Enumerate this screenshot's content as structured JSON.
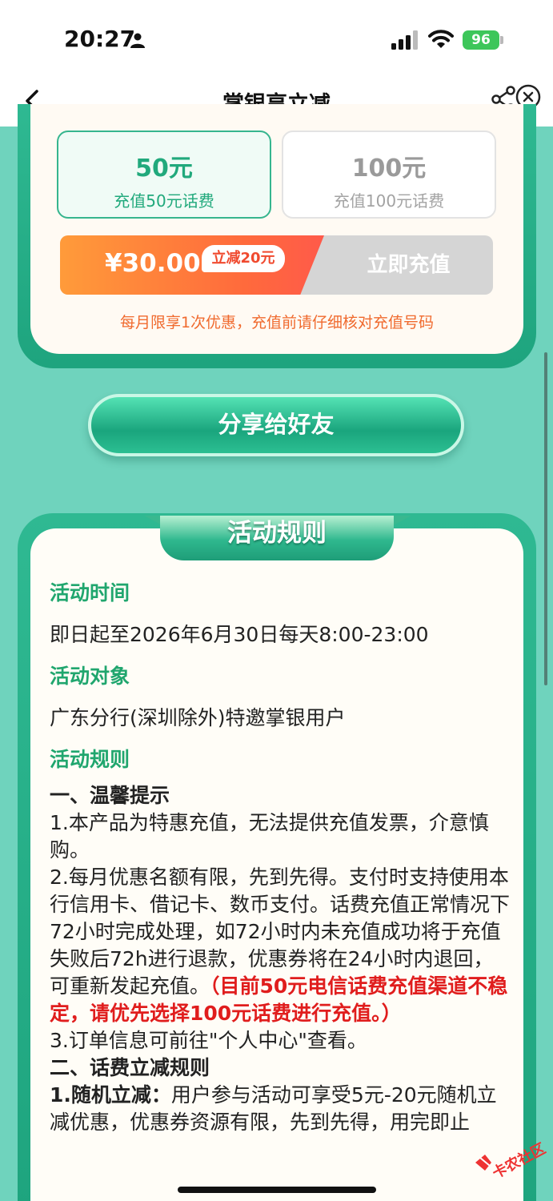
{
  "status_bar": {
    "time": "20:27",
    "battery": "96"
  },
  "nav": {
    "title": "掌银享立减"
  },
  "amount_options": [
    {
      "value": "50元",
      "desc": "充值50元话费",
      "selected": true
    },
    {
      "value": "100元",
      "desc": "充值100元话费",
      "selected": false
    }
  ],
  "pay": {
    "price": "¥30.00",
    "discount_tag": "立减20元",
    "button_label": "立即充值",
    "note": "每月限享1次优惠，充值前请仔细核对充值号码"
  },
  "share_button": "分享给好友",
  "rules": {
    "tab_title": "活动规则",
    "time_heading": "活动时间",
    "time_text": "即日起至2026年6月30日每天8:00-23:00",
    "target_heading": "活动对象",
    "target_text": "广东分行(深圳除外)特邀掌银用户",
    "rules_heading": "活动规则",
    "tips_heading": "一、温馨提示",
    "tip1": "1.本产品为特惠充值，无法提供充值发票，介意慎购。",
    "tip2": "2.每月优惠名额有限，先到先得。支付时支持使用本行信用卡、借记卡、数币支付。话费充值正常情况下72小时完成处理，如72小时内未充值成功将于充值失败后72h进行退款，优惠券将在24小时内退回，可重新发起充值。",
    "tip2_warning": "（目前50元电信话费充值渠道不稳定，请优先选择100元话费进行充值。）",
    "tip3": "3.订单信息可前往\"个人中心\"查看。",
    "discount_heading": "二、话费立减规则",
    "random_label": "1.随机立减：",
    "random_text": "用户参与活动可享受5元-20元随机立减优惠，优惠券资源有限，先到先得，用完即止"
  },
  "watermark": "卡农社区",
  "colors": {
    "brand_green": "#21a97c",
    "frame_green": "#1ea47e",
    "background": "#6fd3bd",
    "warning_red": "#e01d1d",
    "price_orange": "#ff6a3c"
  }
}
